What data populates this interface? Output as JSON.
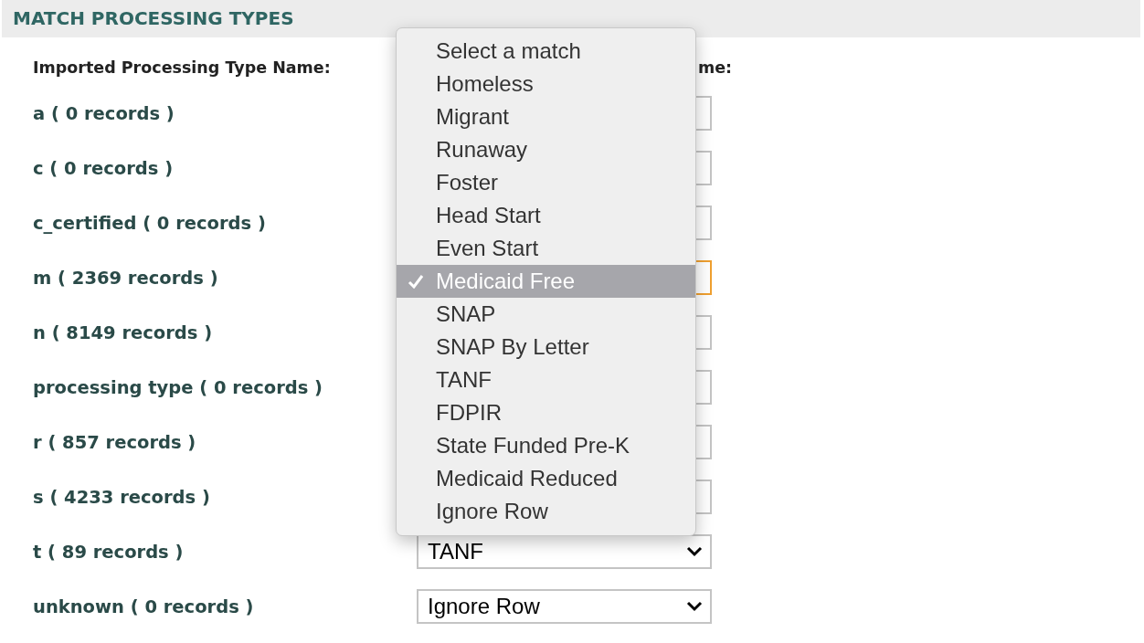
{
  "title": "MATCH PROCESSING TYPES",
  "columns": [
    "Imported Processing Type Name:",
    "me:"
  ],
  "rows": [
    {
      "label": "a ( 0 records )",
      "focused": false
    },
    {
      "label": "c ( 0 records )",
      "focused": false
    },
    {
      "label": "c_certified ( 0 records )",
      "focused": false
    },
    {
      "label": "m ( 2369 records )",
      "focused": true
    },
    {
      "label": "n ( 8149 records )",
      "focused": false
    },
    {
      "label": "processing type ( 0 records )",
      "focused": false
    },
    {
      "label": "r ( 857 records )",
      "focused": false
    },
    {
      "label": "s ( 4233 records )",
      "focused": false
    },
    {
      "label": "t ( 89 records )",
      "focused": false,
      "value": "TANF"
    },
    {
      "label": "unknown ( 0 records )",
      "focused": false,
      "value": "Ignore Row"
    }
  ],
  "menu": {
    "items": [
      {
        "label": "Select a match",
        "selected": false
      },
      {
        "label": "Homeless",
        "selected": false
      },
      {
        "label": "Migrant",
        "selected": false
      },
      {
        "label": "Runaway",
        "selected": false
      },
      {
        "label": "Foster",
        "selected": false
      },
      {
        "label": "Head Start",
        "selected": false
      },
      {
        "label": "Even Start",
        "selected": false
      },
      {
        "label": "Medicaid Free",
        "selected": true
      },
      {
        "label": "SNAP",
        "selected": false
      },
      {
        "label": "SNAP By Letter",
        "selected": false
      },
      {
        "label": "TANF",
        "selected": false
      },
      {
        "label": "FDPIR",
        "selected": false
      },
      {
        "label": "State Funded Pre-K",
        "selected": false
      },
      {
        "label": "Medicaid Reduced",
        "selected": false
      },
      {
        "label": "Ignore Row",
        "selected": false
      }
    ]
  }
}
